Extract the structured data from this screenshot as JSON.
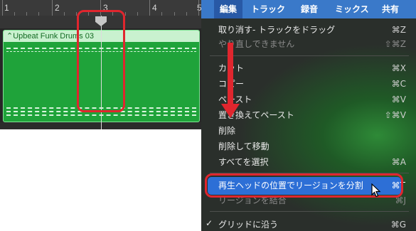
{
  "ruler": {
    "bars": [
      "1",
      "2",
      "3",
      "4",
      "5"
    ]
  },
  "region": {
    "name": "⌃Upbeat Funk Drums 03"
  },
  "menubar": {
    "items": [
      "編集",
      "トラック",
      "録音",
      "ミックス",
      "共有"
    ],
    "active_index": 0
  },
  "menu": {
    "items": [
      {
        "label": "取り消す- トラックをドラッグ",
        "shortcut": "⌘Z",
        "disabled": false
      },
      {
        "label": "やり直しできません",
        "shortcut": "⇧⌘Z",
        "disabled": true
      },
      {
        "label": "カット",
        "shortcut": "⌘X",
        "disabled": false
      },
      {
        "label": "コピー",
        "shortcut": "⌘C",
        "disabled": false
      },
      {
        "label": "ペースト",
        "shortcut": "⌘V",
        "disabled": false
      },
      {
        "label": "置き換えてペースト",
        "shortcut": "⇧⌘V",
        "disabled": false
      },
      {
        "label": "削除",
        "shortcut": "",
        "disabled": false
      },
      {
        "label": "削除して移動",
        "shortcut": "",
        "disabled": false
      },
      {
        "label": "すべてを選択",
        "shortcut": "⌘A",
        "disabled": false
      },
      {
        "label": "再生ヘッドの位置でリージョンを分割",
        "shortcut": "⌘T",
        "disabled": false,
        "highlighted": true
      },
      {
        "label": "リージョンを結合",
        "shortcut": "⌘J",
        "disabled": true
      },
      {
        "label": "グリッドに沿う",
        "shortcut": "⌘G",
        "disabled": false,
        "checked": true
      }
    ]
  },
  "colors": {
    "region_green": "#1fa33a",
    "menu_highlight": "#2d6fd6",
    "annotation_red": "#e0262e",
    "menubar_blue": "#3a79c9"
  }
}
